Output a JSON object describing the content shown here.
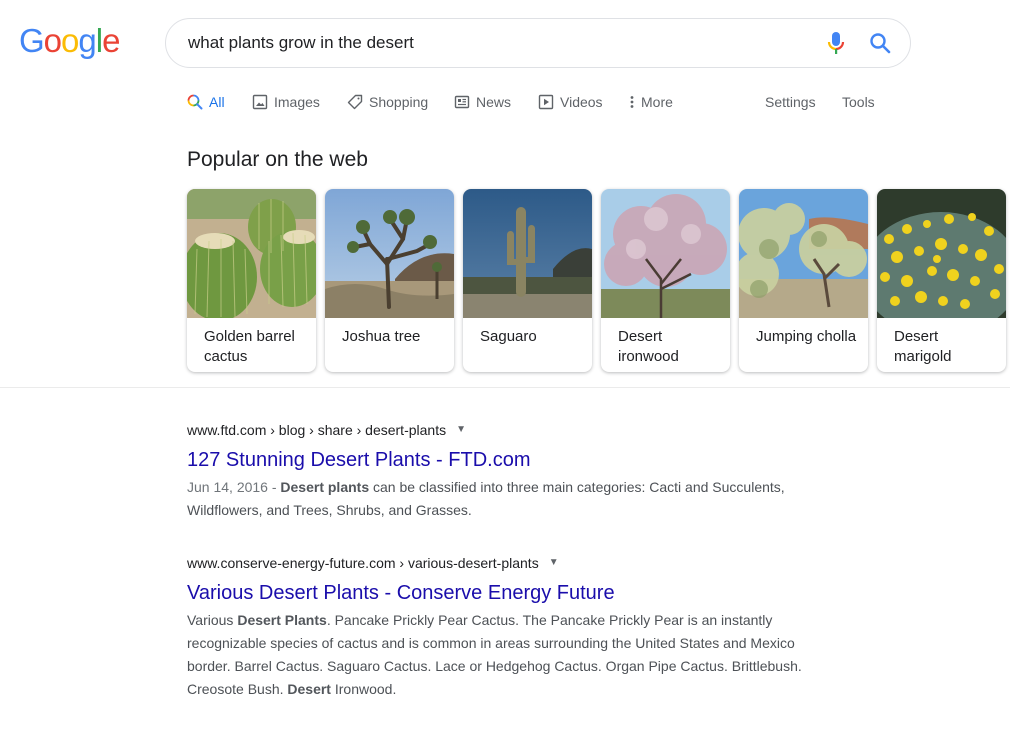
{
  "logo": {
    "letters": [
      "G",
      "o",
      "o",
      "g",
      "l",
      "e"
    ],
    "colors": [
      "#4285f4",
      "#ea4335",
      "#fbbc05",
      "#4285f4",
      "#34a853",
      "#ea4335"
    ]
  },
  "search": {
    "query": "what plants grow in the desert",
    "mic_icon": "microphone-icon",
    "search_icon": "search-icon"
  },
  "tabs": [
    {
      "label": "All",
      "icon": "search-icon",
      "active": true
    },
    {
      "label": "Images",
      "icon": "image-icon"
    },
    {
      "label": "Shopping",
      "icon": "tag-icon"
    },
    {
      "label": "News",
      "icon": "newspaper-icon"
    },
    {
      "label": "Videos",
      "icon": "play-icon"
    },
    {
      "label": "More",
      "icon": "more-vert-icon"
    },
    {
      "label": "Settings"
    },
    {
      "label": "Tools"
    }
  ],
  "popular": {
    "title": "Popular on the web",
    "items": [
      {
        "label": "Golden barrel cactus",
        "image": "golden-barrel-cactus-photo"
      },
      {
        "label": "Joshua tree",
        "image": "joshua-tree-photo"
      },
      {
        "label": "Saguaro",
        "image": "saguaro-photo"
      },
      {
        "label": "Desert ironwood",
        "image": "desert-ironwood-photo"
      },
      {
        "label": "Jumping cholla",
        "image": "jumping-cholla-photo"
      },
      {
        "label": "Desert marigold",
        "image": "desert-marigold-photo"
      }
    ]
  },
  "results": [
    {
      "cite": "www.ftd.com › blog › share › desert-plants",
      "title": "127 Stunning Desert Plants - FTD.com",
      "date": "Jun 14, 2016 - ",
      "snippet_parts": [
        {
          "text": "Desert plants",
          "bold": true
        },
        {
          "text": " can be classified into three main categories: Cacti and Succulents, Wildflowers, and Trees, Shrubs, and Grasses.",
          "bold": false
        }
      ]
    },
    {
      "cite": "www.conserve-energy-future.com › various-desert-plants",
      "title": "Various Desert Plants - Conserve Energy Future",
      "date": "",
      "snippet_parts": [
        {
          "text": "Various ",
          "bold": false
        },
        {
          "text": "Desert Plants",
          "bold": true
        },
        {
          "text": ". Pancake Prickly Pear Cactus. The Pancake Prickly Pear is an instantly recognizable species of cactus and is common in areas surrounding the United States and Mexico border. Barrel Cactus. Saguaro Cactus. Lace or Hedgehog Cactus. Organ Pipe Cactus. Brittlebush. Creosote Bush. ",
          "bold": false
        },
        {
          "text": "Desert",
          "bold": true
        },
        {
          "text": " Ironwood.",
          "bold": false
        }
      ]
    }
  ],
  "colors": {
    "link": "#1a0dab",
    "active_tab": "#1a73e8",
    "muted": "#5f6368"
  }
}
